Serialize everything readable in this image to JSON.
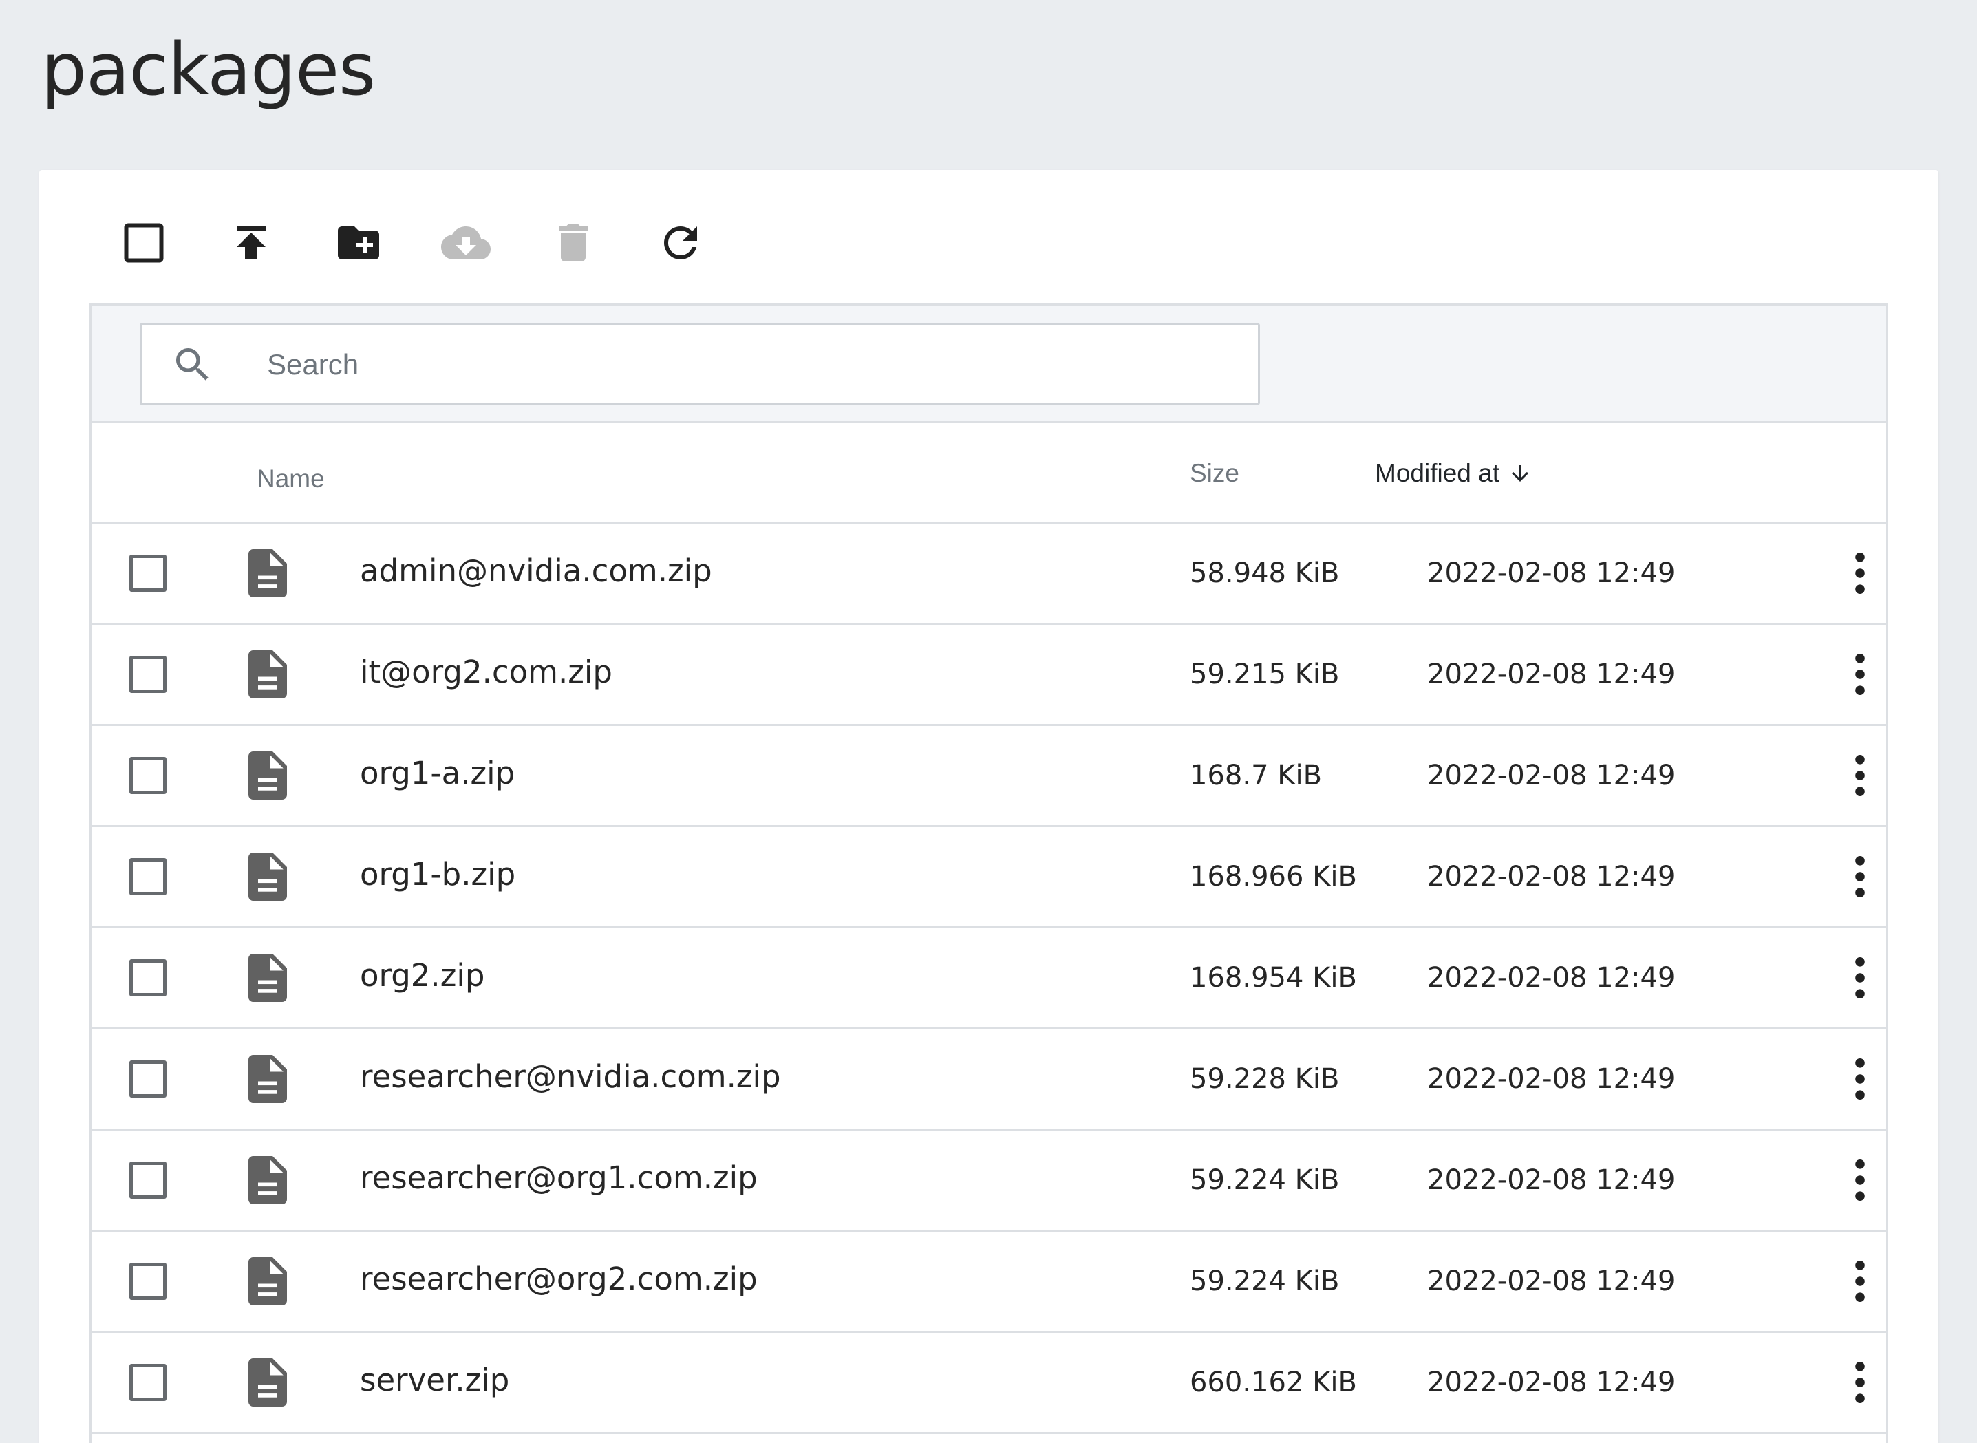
{
  "page": {
    "title": "packages"
  },
  "toolbar": {
    "buttons": [
      {
        "icon": "select-all-checkbox-icon",
        "enabled": true
      },
      {
        "icon": "upload-icon",
        "enabled": true
      },
      {
        "icon": "new-folder-icon",
        "enabled": true
      },
      {
        "icon": "cloud-download-icon",
        "enabled": false
      },
      {
        "icon": "trash-icon",
        "enabled": false
      },
      {
        "icon": "refresh-icon",
        "enabled": true
      }
    ]
  },
  "search": {
    "placeholder": "Search",
    "value": ""
  },
  "table": {
    "columns": {
      "name": "Name",
      "size": "Size",
      "modified": "Modified at"
    },
    "sort": {
      "column": "modified",
      "direction": "desc"
    },
    "rows": [
      {
        "name": "admin@nvidia.com.zip",
        "size": "58.948 KiB",
        "modified": "2022-02-08 12:49"
      },
      {
        "name": "it@org2.com.zip",
        "size": "59.215 KiB",
        "modified": "2022-02-08 12:49"
      },
      {
        "name": "org1-a.zip",
        "size": "168.7 KiB",
        "modified": "2022-02-08 12:49"
      },
      {
        "name": "org1-b.zip",
        "size": "168.966 KiB",
        "modified": "2022-02-08 12:49"
      },
      {
        "name": "org2.zip",
        "size": "168.954 KiB",
        "modified": "2022-02-08 12:49"
      },
      {
        "name": "researcher@nvidia.com.zip",
        "size": "59.228 KiB",
        "modified": "2022-02-08 12:49"
      },
      {
        "name": "researcher@org1.com.zip",
        "size": "59.224 KiB",
        "modified": "2022-02-08 12:49"
      },
      {
        "name": "researcher@org2.com.zip",
        "size": "59.224 KiB",
        "modified": "2022-02-08 12:49"
      },
      {
        "name": "server.zip",
        "size": "660.162 KiB",
        "modified": "2022-02-08 12:49"
      }
    ]
  },
  "colors": {
    "background": "#eaedf0",
    "card": "#ffffff",
    "icon_active": "#212121",
    "icon_disabled": "#bdbdbd",
    "file_icon": "#616161",
    "border": "#dcdfe3"
  }
}
